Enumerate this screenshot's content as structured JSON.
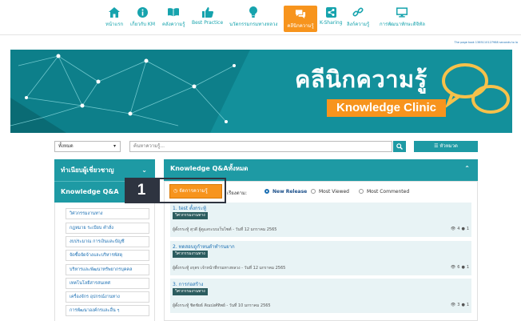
{
  "nav": {
    "items": [
      {
        "label": "หน้าแรก",
        "icon": "home-icon"
      },
      {
        "label": "เกี่ยวกับ KM",
        "icon": "info-icon"
      },
      {
        "label": "คลังความรู้",
        "icon": "book-icon"
      },
      {
        "label": "Best Practice",
        "icon": "thumbs-up-icon"
      },
      {
        "label": "นวัตกรรมกรมทางหลวง",
        "icon": "lightbulb-icon"
      },
      {
        "label": "คลีนิกความรู้",
        "icon": "chat-icon"
      },
      {
        "label": "K-Sharing",
        "icon": "share-icon"
      },
      {
        "label": "ลิงก์ความรู้",
        "icon": "link-icon"
      },
      {
        "label": "การพัฒนาทักษะดิจิทัล",
        "icon": "monitor-icon"
      }
    ]
  },
  "note": "The page took 1385110127988 seconds to lo",
  "banner": {
    "title": "คลีนิกความรู้",
    "subtitle": "Knowledge Clinic"
  },
  "search": {
    "select_value": "ทั้งหมด",
    "placeholder": "ค้นหาความรู้...",
    "category_label": "☰ หัวหมวด"
  },
  "sidebar": {
    "experts_header": "ทำเนียบผู้เชี่ยวชาญ",
    "qa_header": "Knowledge Q&A",
    "items": [
      "วิศวกรรมงานทาง",
      "กฎหมาย ระเบียบ คำสั่ง",
      "งบประมาณ การเงินและบัญชี",
      "จัดซื้อจัดจ้างและบริหารพัสดุ",
      "บริหารและพัฒนาทรัพยากรบุคคล",
      "เทคโนโลยีสารสนเทศ",
      "เครื่องจักร อุปกรณ์งานทาง",
      "การพัฒนาองค์กรและอื่น ๆ"
    ]
  },
  "main": {
    "header": "Knowledge Q&Aทั้งหมด",
    "manage_label": "จัดการความรู้",
    "sort_label": "เรียงตาม:",
    "sort_options": [
      "New Release",
      "Most Viewed",
      "Most Commented"
    ],
    "selected_sort": "New Release"
  },
  "questions": [
    {
      "title": "1. test ตั้งกระทู้",
      "tag": "วิศวกรรมงานทาง",
      "meta": "ผู้ตั้งกระทู้ สุวดี ผู้ดูแลระบบเว็บไซต์ - วันที่ 12 มกราคม 2565",
      "views": "4",
      "comments": "1"
    },
    {
      "title": "2. ทดสอบถูกำหนดำทำรนยาก",
      "tag": "วิศวกรรมงานทาง",
      "meta": "ผู้ตั้งกระทู้ อรุตร เจ้าหน้าที่กรมทางหลวง - วันที่ 12 มกราคม 2565",
      "views": "6",
      "comments": "1"
    },
    {
      "title": "3. การก่อสร้าง",
      "tag": "วิศวกรรมงานทาง",
      "meta": "ผู้ตั้งกระทู้ ชิตชัยธ์ คิณปงศ์ทิพย์ - วันที่ 10 มกราคม 2565",
      "views": "3",
      "comments": "1"
    }
  ],
  "step_number": "1",
  "colors": {
    "teal": "#1e9aa4",
    "orange": "#f7941d",
    "dark": "#2e3440"
  }
}
